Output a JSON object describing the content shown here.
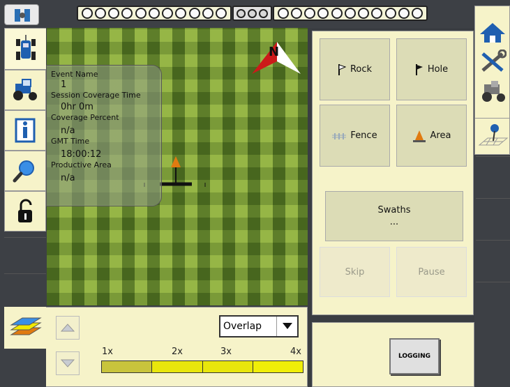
{
  "info": {
    "event_name_label": "Event Name",
    "event_name_value": "1",
    "coverage_time_label": "Session Coverage Time",
    "coverage_time_value": "0hr 0m",
    "coverage_pct_label": "Coverage Percent",
    "coverage_pct_value": "n/a",
    "gmt_label": "GMT Time",
    "gmt_value": "18:00:12",
    "productive_area_label": "Productive Area",
    "productive_area_value": "n/a"
  },
  "compass": {
    "letter": "N"
  },
  "actions": {
    "rock": "Rock",
    "hole": "Hole",
    "fence": "Fence",
    "area": "Area",
    "swaths_label": "Swaths",
    "swaths_value": "...",
    "skip": "Skip",
    "pause": "Pause"
  },
  "bottom": {
    "select_value": "Overlap",
    "scale_labels": [
      "1x",
      "2x",
      "3x",
      "4x"
    ],
    "scale_colors": [
      "#c8c43c",
      "#e8e60c",
      "#e8e60c",
      "#f0ee08"
    ]
  },
  "logging": {
    "label": "LOGGING"
  },
  "colors": {
    "panel": "#f6f3c9",
    "button": "#dcdcb6",
    "frame": "#3d4045"
  }
}
